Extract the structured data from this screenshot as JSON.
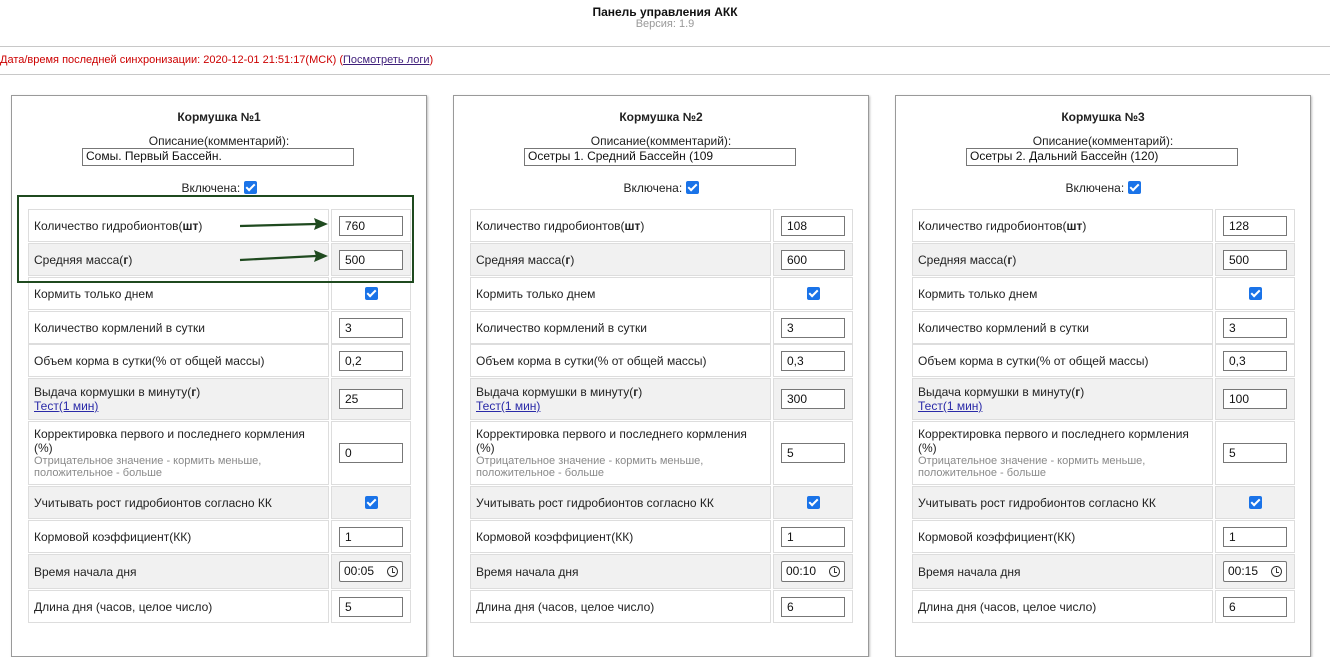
{
  "header": {
    "title": "Панель управления АКК",
    "version": "Версия: 1.9"
  },
  "sync": {
    "text": "Дата/время последней синхронизации: 2020-12-01 21:51:17(МСК) (",
    "link": "Посмотреть логи",
    "close": ")"
  },
  "labels": {
    "description": "Описание(комментарий):",
    "enabled": "Включена:",
    "count_a": "Количество гидробионтов(",
    "count_b": "шт",
    "count_c": ")",
    "mass_a": "Средняя масса(",
    "mass_b": "г",
    "mass_c": ")",
    "day_only": "Кормить только днем",
    "feedings": "Количество кормлений в сутки",
    "volume_a": "Объем корма в сутки(",
    "volume_b": "% от общей массы)",
    "output_a": "Выдача кормушки в минуту(",
    "output_b": "г",
    "output_c": ")",
    "test": "Тест",
    "test_1min": "(1 мин)",
    "correction_title": "Корректировка первого и последнего кормления (%)",
    "correction_note": "Отрицательное значение - кормить меньше, положительное - больше",
    "growth": "Учитывать рост гидробионтов согласно КК",
    "coef": "Кормовой коэффициент(КК)",
    "day_start": "Время начала дня",
    "day_length": "Длина дня (часов, целое число)"
  },
  "feeders": [
    {
      "title": "Кормушка №1",
      "description": "Сомы. Первый Бассейн.",
      "count": "760",
      "mass": "500",
      "feedings": "3",
      "volume": "0,2",
      "output": "25",
      "correction": "0",
      "coef": "1",
      "day_start": "00:05",
      "day_length": "5"
    },
    {
      "title": "Кормушка №2",
      "description": "Осетры 1. Средний Бассейн (109",
      "count": "108",
      "mass": "600",
      "feedings": "3",
      "volume": "0,3",
      "output": "300",
      "correction": "5",
      "coef": "1",
      "day_start": "00:10",
      "day_length": "6"
    },
    {
      "title": "Кормушка №3",
      "description": "Осетры 2. Дальний Бассейн (120)",
      "count": "128",
      "mass": "500",
      "feedings": "3",
      "volume": "0,3",
      "output": "100",
      "correction": "5",
      "coef": "1",
      "day_start": "00:15",
      "day_length": "6"
    }
  ],
  "colors": {
    "checkbox": "#1a73e8",
    "sync_text": "#cc0000",
    "annotation": "#1f4a1f"
  }
}
